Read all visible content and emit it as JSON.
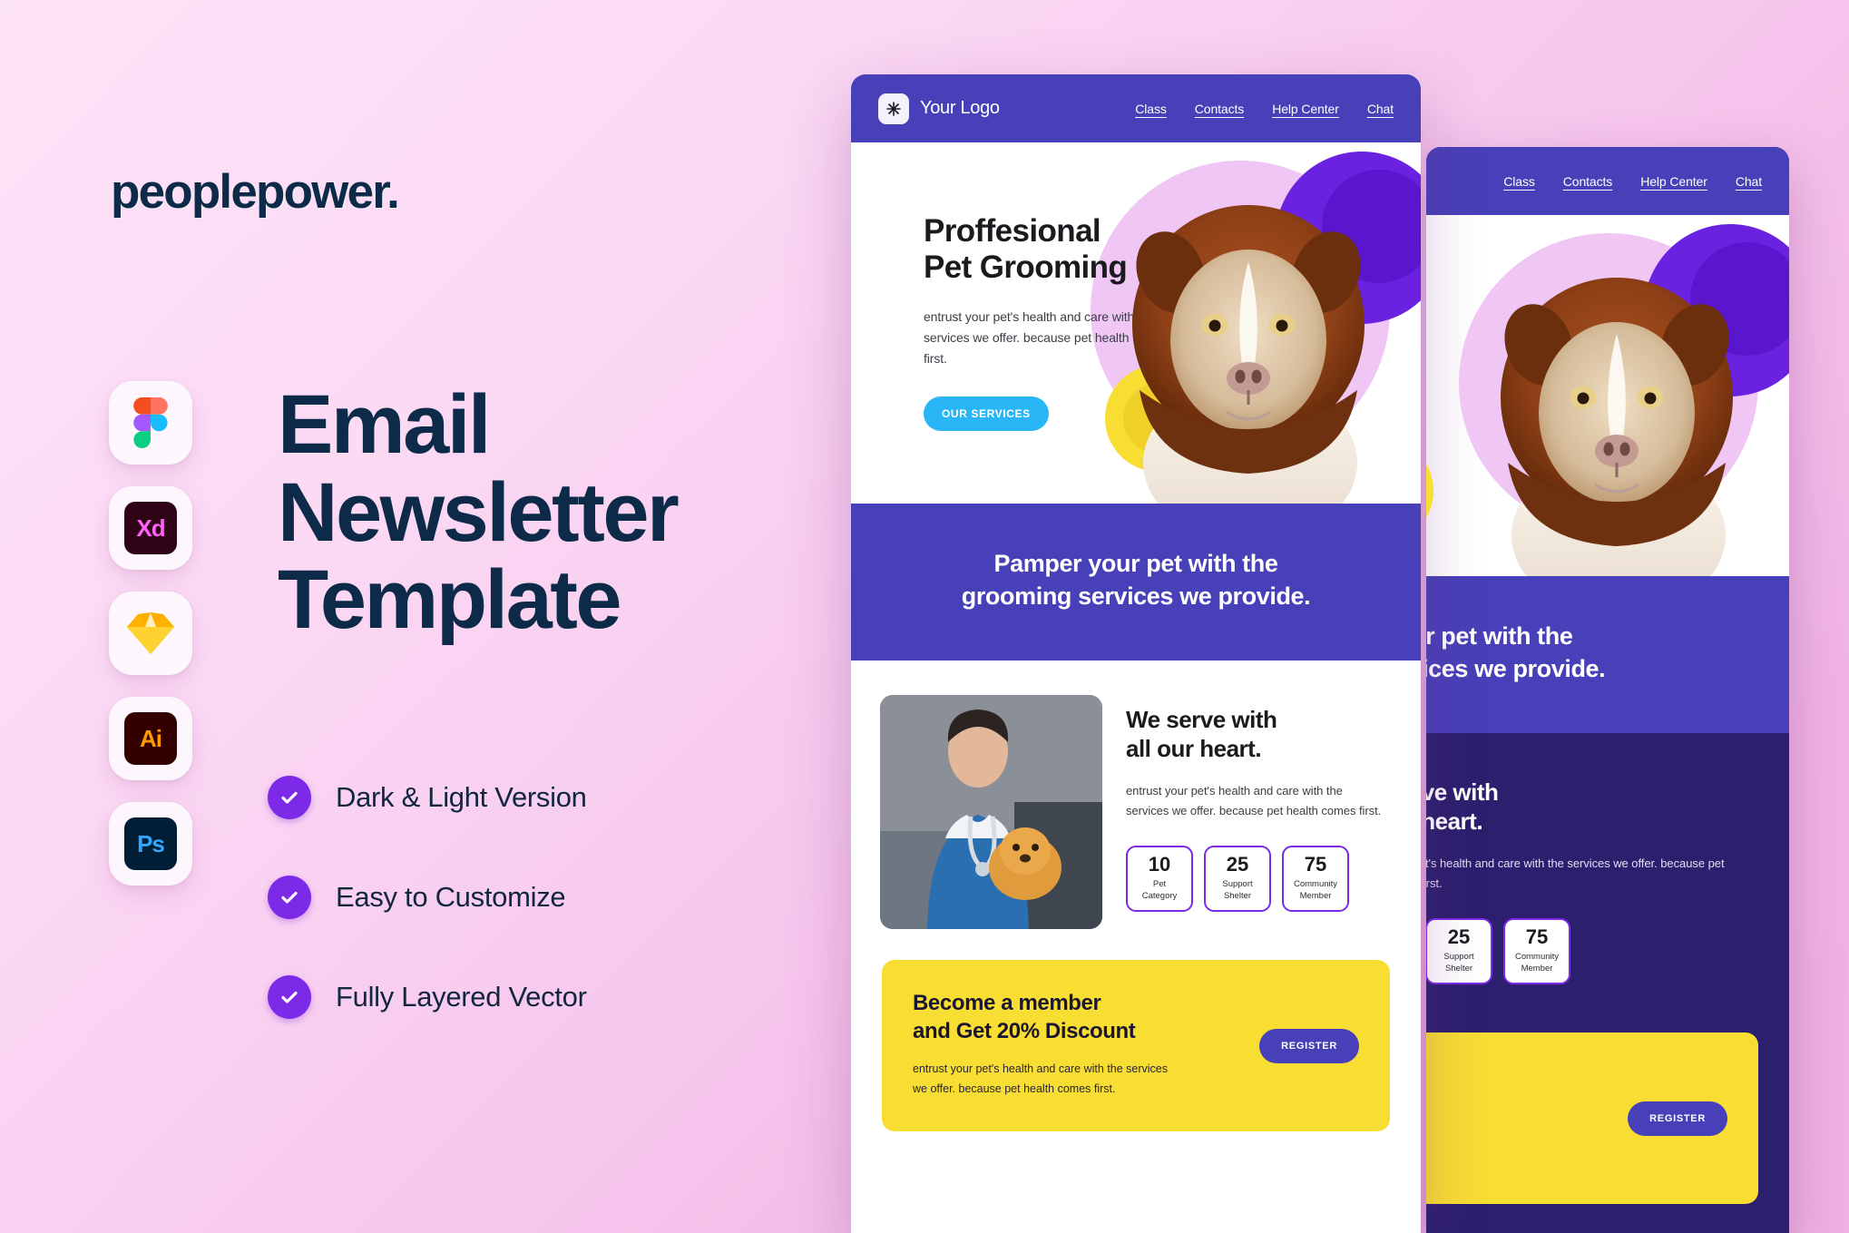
{
  "brand": {
    "wordmark": "peoplepower."
  },
  "headline": {
    "line1": "Email",
    "line2": "Newsletter",
    "line3": "Template"
  },
  "tools": [
    {
      "name": "figma-icon",
      "label": "Figma"
    },
    {
      "name": "adobe-xd-icon",
      "label": "Xd"
    },
    {
      "name": "sketch-icon",
      "label": "Sketch"
    },
    {
      "name": "adobe-illustrator-icon",
      "label": "Ai"
    },
    {
      "name": "adobe-photoshop-icon",
      "label": "Ps"
    }
  ],
  "features": [
    {
      "label": "Dark & Light Version"
    },
    {
      "label": "Easy to Customize"
    },
    {
      "label": "Fully Layered Vector"
    }
  ],
  "colors": {
    "accent_purple": "#7c2ae8",
    "brand_indigo": "#4840b8",
    "dark_indigo": "#2b1f6e",
    "yellow": "#f8dd33",
    "cyan": "#29b6f6",
    "navy_text": "#0d2b49"
  },
  "email": {
    "nav": {
      "logo_text": "Your Logo",
      "links": [
        "Class",
        "Contacts",
        "Help Center",
        "Chat"
      ]
    },
    "hero": {
      "title_line1": "Proffesional",
      "title_line2": "Pet Grooming",
      "subtitle": "entrust your pet's health and care with the services we offer. because pet health comes first.",
      "button": "OUR SERVICES"
    },
    "band": {
      "line1": "Pamper your pet with the",
      "line2": "grooming services we provide."
    },
    "serve": {
      "title_line1": "We serve with",
      "title_line2": "all our heart.",
      "subtitle": "entrust your pet's health and care with the services we offer. because pet health comes first.",
      "stats": [
        {
          "number": "10",
          "label_line1": "Pet",
          "label_line2": "Category"
        },
        {
          "number": "25",
          "label_line1": "Support",
          "label_line2": "Shelter"
        },
        {
          "number": "75",
          "label_line1": "Community",
          "label_line2": "Member"
        }
      ]
    },
    "cta": {
      "title_line1": "Become a member",
      "title_line2": "and Get 20% Discount",
      "subtitle": "entrust your pet's health and care with the services we offer. because pet health comes first.",
      "button": "REGISTER"
    }
  }
}
